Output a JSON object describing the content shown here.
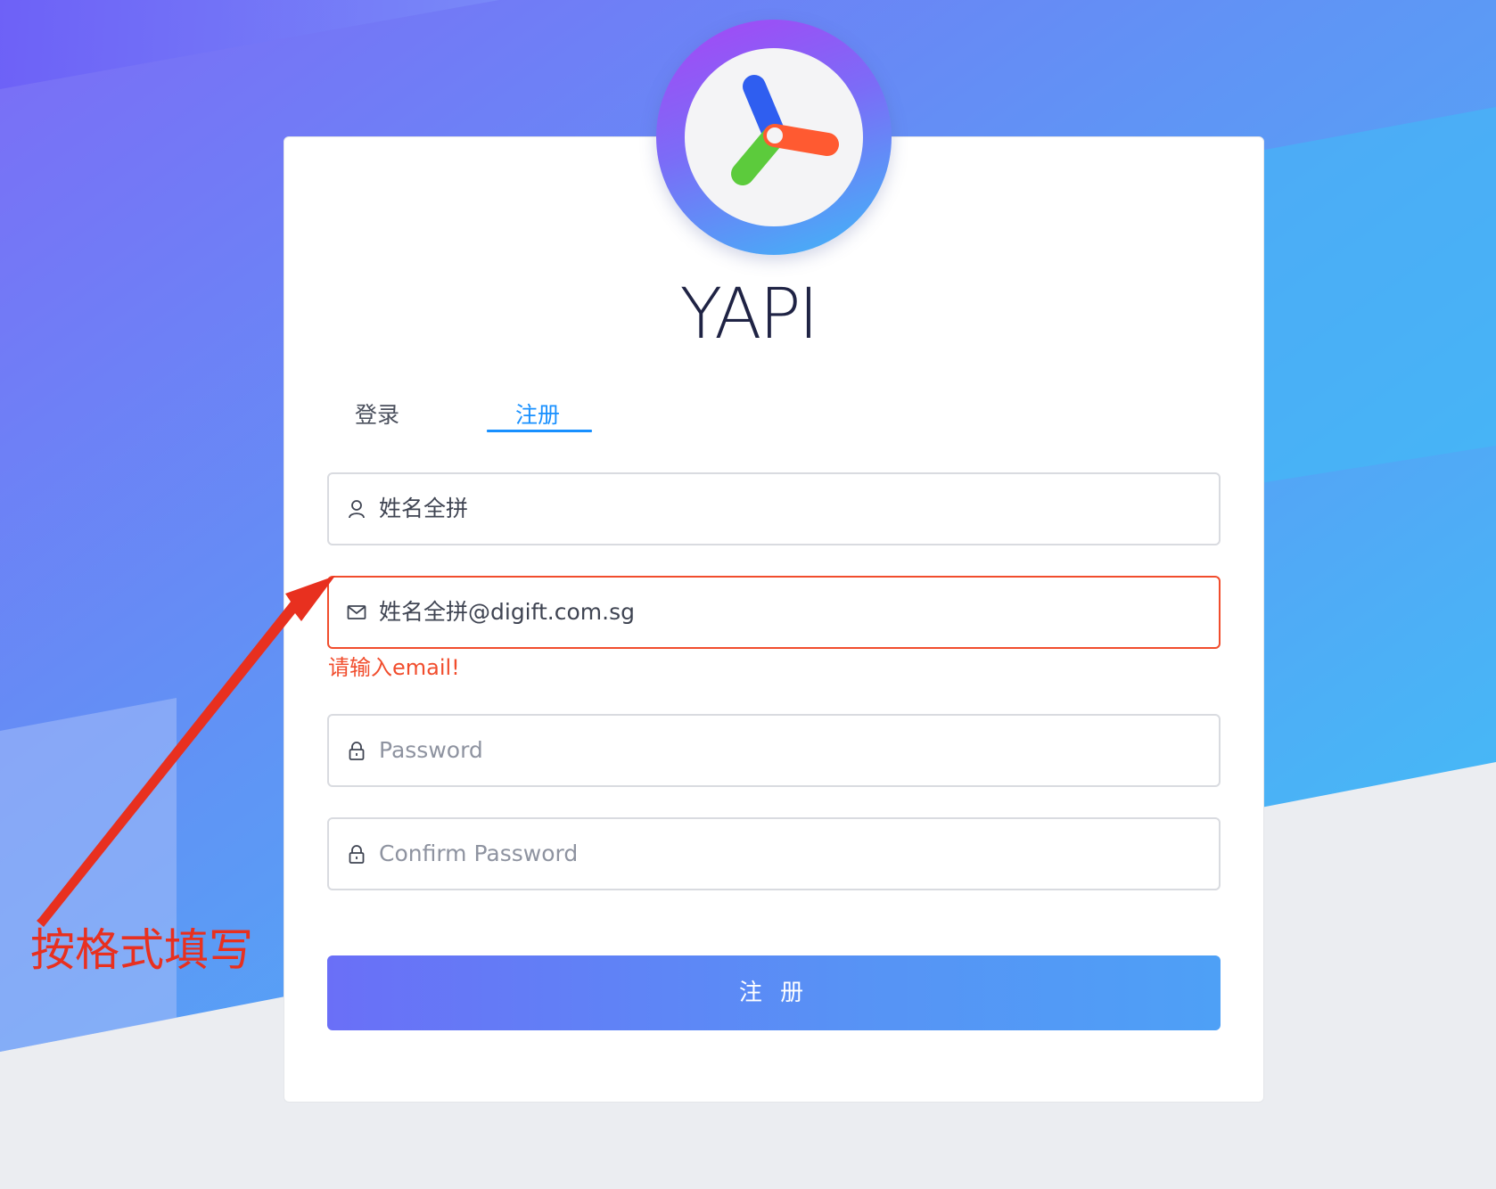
{
  "brand": {
    "name": "YAPI"
  },
  "tabs": [
    {
      "label": "登录",
      "active": false
    },
    {
      "label": "注册",
      "active": true
    }
  ],
  "form": {
    "username": {
      "value": "姓名全拼",
      "icon": "user-icon"
    },
    "email": {
      "value": "姓名全拼@digift.com.sg",
      "icon": "mail-icon",
      "error": "请输入email!"
    },
    "password": {
      "placeholder": "Password",
      "icon": "lock-icon"
    },
    "confirm_password": {
      "placeholder": "Confirm Password",
      "icon": "lock-icon"
    },
    "submit_label": "注 册"
  },
  "annotation": {
    "text": "按格式填写",
    "color": "#e8301f"
  },
  "colors": {
    "accent": "#1890ff",
    "error": "#f14d2d",
    "button_start": "#6a6ff7",
    "button_end": "#4ea0f6"
  }
}
